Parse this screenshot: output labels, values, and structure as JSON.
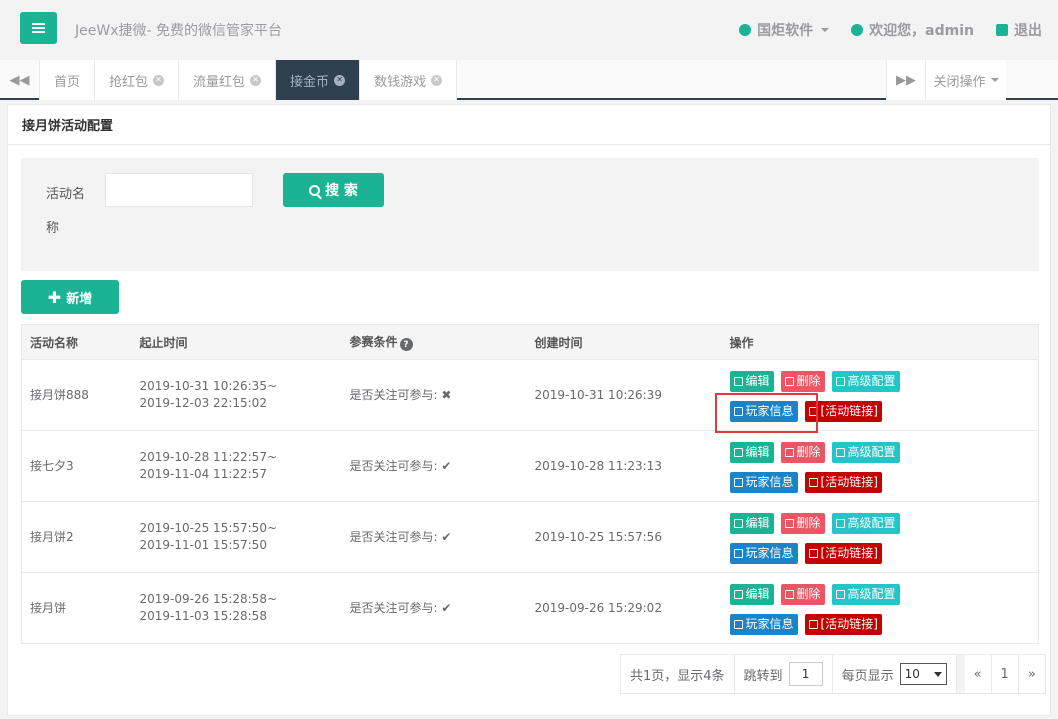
{
  "header": {
    "brand": "JeeWx捷微- 免费的微信管家平台",
    "org": "国炬软件",
    "welcome": "欢迎您，admin",
    "logout": "退出"
  },
  "tabs": [
    {
      "label": "首页",
      "closable": false
    },
    {
      "label": "抢红包",
      "closable": true
    },
    {
      "label": "流量红包",
      "closable": true
    },
    {
      "label": "接金币",
      "closable": true,
      "active": true
    },
    {
      "label": "数钱游戏",
      "closable": true
    }
  ],
  "tab_close_ops": "关闭操作",
  "panel": {
    "title": "接月饼活动配置",
    "search_label": "活动名称",
    "search_value": "",
    "search_button": "搜 索",
    "add_button": "新增"
  },
  "table": {
    "headers": [
      "活动名称",
      "起止时间",
      "参赛条件",
      "创建时间",
      "操作"
    ],
    "rows": [
      {
        "name": "接月饼888",
        "start": "2019-10-31 10:26:35~",
        "end": "2019-12-03 22:15:02",
        "cond": "是否关注可参与:",
        "cond_mark": "✖",
        "created": "2019-10-31 10:26:39"
      },
      {
        "name": "接七夕3",
        "start": "2019-10-28 11:22:57~",
        "end": "2019-11-04 11:22:57",
        "cond": "是否关注可参与:",
        "cond_mark": "✔",
        "created": "2019-10-28 11:23:13"
      },
      {
        "name": "接月饼2",
        "start": "2019-10-25 15:57:50~",
        "end": "2019-11-01 15:57:50",
        "cond": "是否关注可参与:",
        "cond_mark": "✔",
        "created": "2019-10-25 15:57:56"
      },
      {
        "name": "接月饼",
        "start": "2019-09-26 15:28:58~",
        "end": "2019-11-03 15:28:58",
        "cond": "是否关注可参与:",
        "cond_mark": "✔",
        "created": "2019-09-26 15:29:02"
      }
    ],
    "ops": {
      "edit": "编辑",
      "del": "删除",
      "adv": "高级配置",
      "players": "玩家信息",
      "link": "[活动链接]"
    }
  },
  "pager": {
    "summary": "共1页，显示4条",
    "jump_label": "跳转到",
    "jump_value": "1",
    "per_page_label": "每页显示",
    "per_page_value": "10",
    "prev": "«",
    "page": "1",
    "next": "»"
  }
}
